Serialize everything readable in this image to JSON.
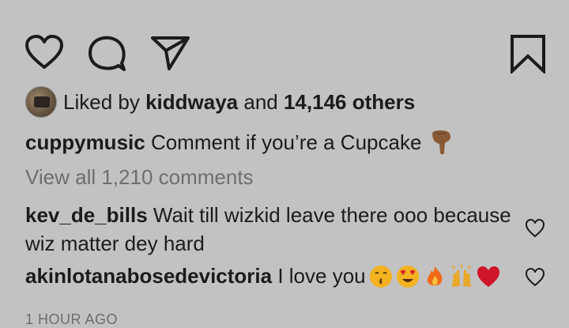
{
  "actions": {
    "like_icon": "heart-outline-icon",
    "comment_icon": "comment-bubble-icon",
    "share_icon": "paper-plane-icon",
    "save_icon": "bookmark-icon"
  },
  "likes": {
    "prefix": "Liked by ",
    "user": "kiddwaya",
    "middle": " and ",
    "count_text": "14,146 others"
  },
  "caption": {
    "user": "cuppymusic",
    "text": " Comment if you’re a Cupcake",
    "emoji": "backhand-index-pointing-down"
  },
  "view_all": "View all 1,210 comments",
  "comments": [
    {
      "user": "kev_de_bills",
      "text": " Wait till wizkid leave there ooo because wiz matter dey hard"
    },
    {
      "user": "akinlotanabosedevictoria",
      "text": " I love you",
      "emojis": [
        "kissing-face",
        "heart-eyes-face",
        "fire",
        "raising-hands",
        "red-heart"
      ]
    }
  ],
  "timestamp": "1 HOUR AGO",
  "colors": {
    "background": "#c2c2c2",
    "text": "#1b1b1b",
    "muted": "#6e6e6e"
  }
}
